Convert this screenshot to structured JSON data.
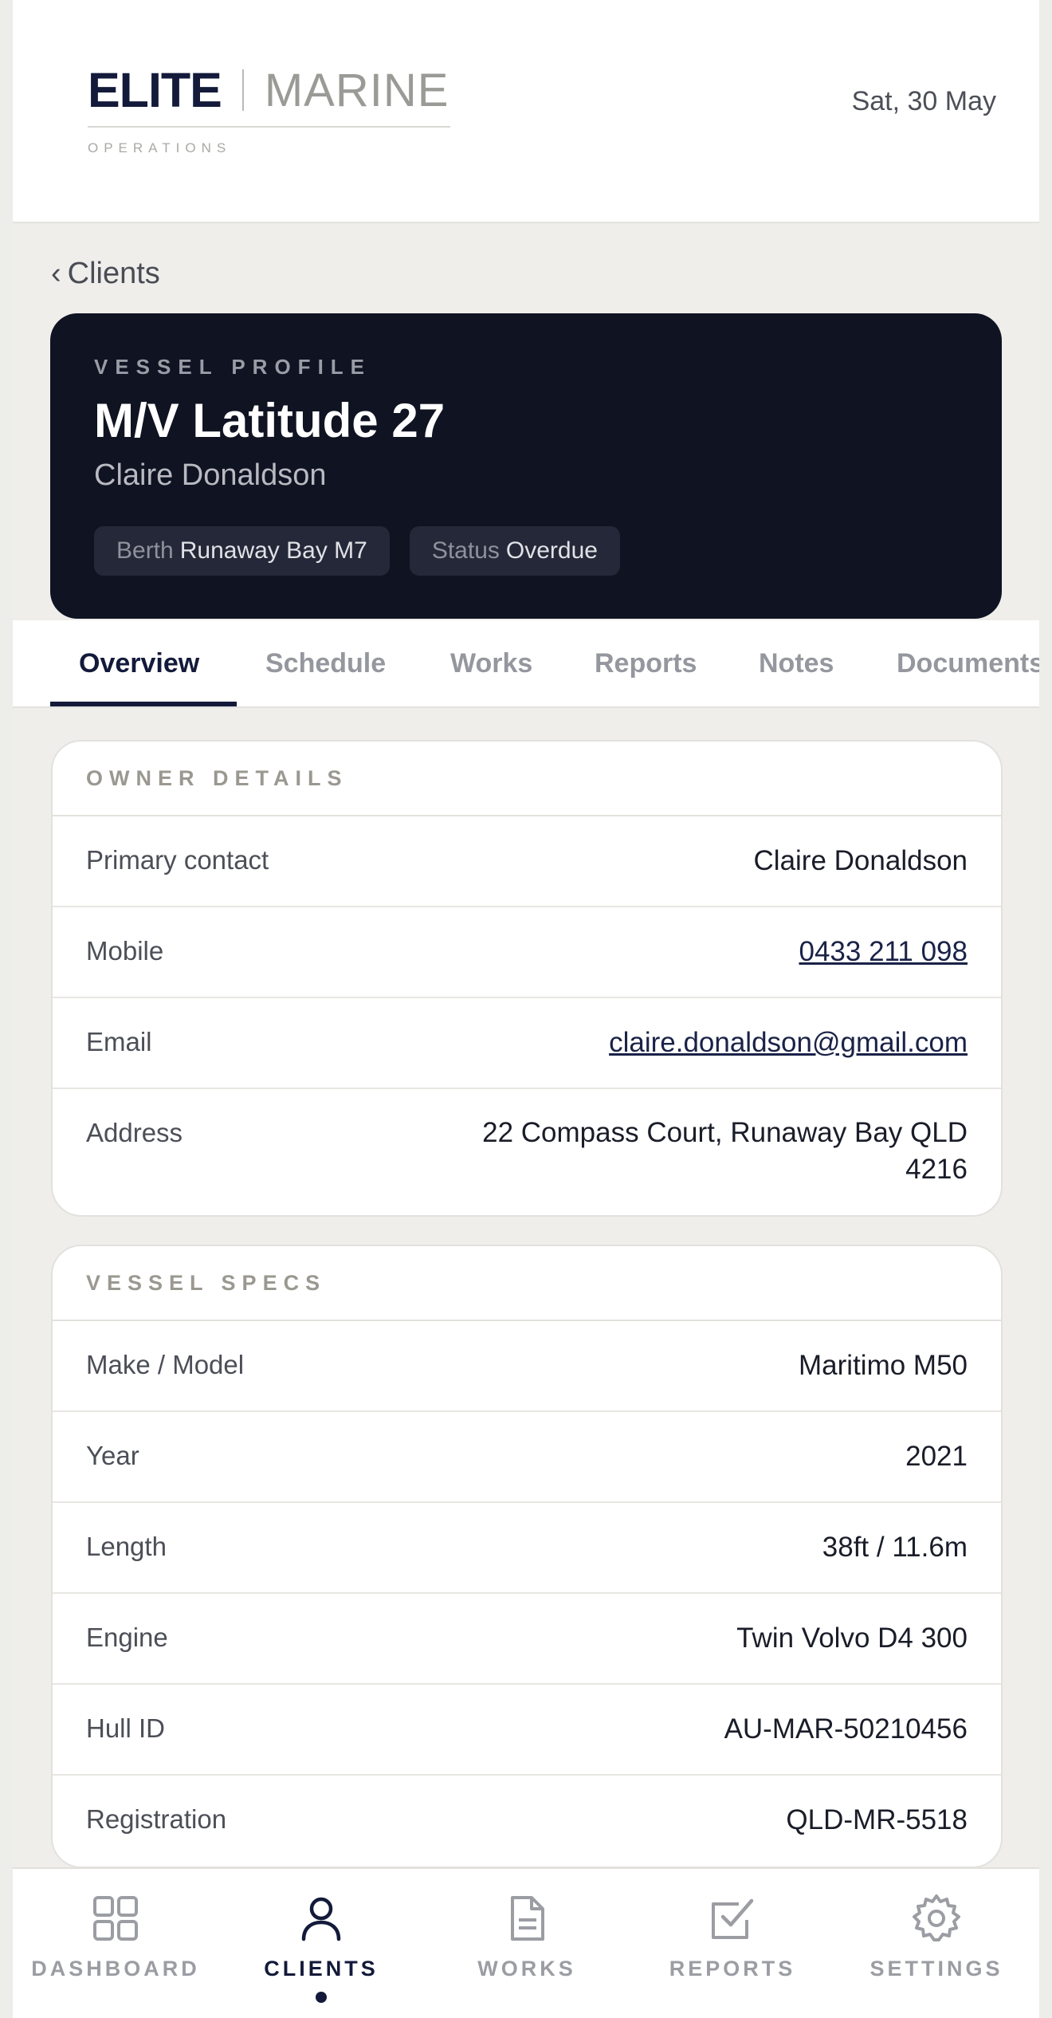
{
  "header": {
    "logo_primary": "ELITE",
    "logo_secondary": "MARINE",
    "logo_tagline": "OPERATIONS",
    "date": "Sat, 30 May"
  },
  "back": {
    "chevron": "‹",
    "label": "Clients"
  },
  "vessel": {
    "eyebrow": "VESSEL PROFILE",
    "name": "M/V Latitude 27",
    "owner": "Claire Donaldson",
    "chips": [
      {
        "key": "Berth",
        "value": "Runaway Bay M7"
      },
      {
        "key": "Status",
        "value": "Overdue"
      }
    ]
  },
  "tabs": [
    {
      "label": "Overview",
      "active": true
    },
    {
      "label": "Schedule"
    },
    {
      "label": "Works"
    },
    {
      "label": "Reports"
    },
    {
      "label": "Notes"
    },
    {
      "label": "Documents"
    }
  ],
  "owner_details": {
    "title": "OWNER DETAILS",
    "rows": [
      {
        "label": "Primary contact",
        "value": "Claire Donaldson"
      },
      {
        "label": "Mobile",
        "value": "0433 211 098"
      },
      {
        "label": "Email",
        "value": "claire.donaldson@gmail.com"
      },
      {
        "label": "Address",
        "value": "22 Compass Court, Runaway Bay QLD 4216"
      }
    ]
  },
  "vessel_specs": {
    "title": "VESSEL SPECS",
    "rows": [
      {
        "label": "Make / Model",
        "value": "Maritimo M50"
      },
      {
        "label": "Year",
        "value": "2021"
      },
      {
        "label": "Length",
        "value": "38ft / 11.6m"
      },
      {
        "label": "Engine",
        "value": "Twin Volvo D4 300"
      },
      {
        "label": "Hull ID",
        "value": "AU-MAR-50210456"
      },
      {
        "label": "Registration",
        "value": "QLD-MR-5518"
      }
    ]
  },
  "bottom_nav": [
    {
      "label": "DASHBOARD",
      "icon": "dashboard-grid-icon"
    },
    {
      "label": "CLIENTS",
      "icon": "person-icon",
      "active": true
    },
    {
      "label": "WORKS",
      "icon": "document-icon"
    },
    {
      "label": "REPORTS",
      "icon": "checkbox-icon"
    },
    {
      "label": "SETTINGS",
      "icon": "gear-icon"
    }
  ],
  "colors": {
    "navy": "#131a3a",
    "hero_bg": "#0f1322",
    "page_bg": "#efeeeb"
  }
}
